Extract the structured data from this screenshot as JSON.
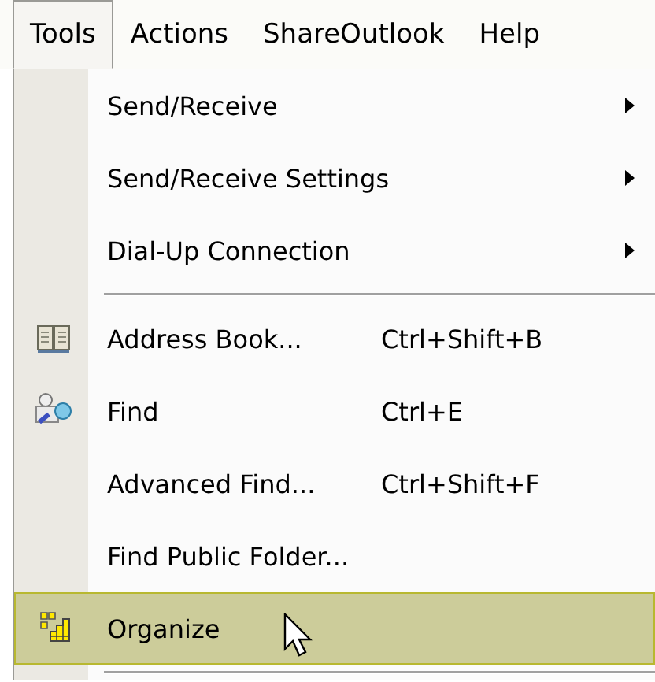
{
  "menu_bar": [
    {
      "label": "Tools",
      "selected": true
    },
    {
      "label": "Actions",
      "selected": false
    },
    {
      "label": "ShareOutlook",
      "selected": false
    },
    {
      "label": "Help",
      "selected": false
    }
  ],
  "menu": [
    {
      "kind": "item",
      "label": "Send/Receive",
      "submenu": true,
      "selected": false
    },
    {
      "kind": "item",
      "label": "Send/Receive Settings",
      "submenu": true,
      "selected": false
    },
    {
      "kind": "item",
      "label": "Dial-Up Connection",
      "submenu": true,
      "selected": false
    },
    {
      "kind": "separator"
    },
    {
      "kind": "item",
      "label": "Address Book...",
      "shortcut": "Ctrl+Shift+B",
      "submenu": false,
      "selected": false
    },
    {
      "kind": "item",
      "label": "Find",
      "shortcut": "Ctrl+E",
      "submenu": false,
      "selected": false
    },
    {
      "kind": "item",
      "label": "Advanced Find...",
      "shortcut": "Ctrl+Shift+F",
      "submenu": false,
      "selected": false
    },
    {
      "kind": "item",
      "label": "Find Public Folder...",
      "submenu": false,
      "selected": false
    },
    {
      "kind": "item",
      "label": "Organize",
      "submenu": false,
      "selected": true
    },
    {
      "kind": "separator"
    }
  ]
}
